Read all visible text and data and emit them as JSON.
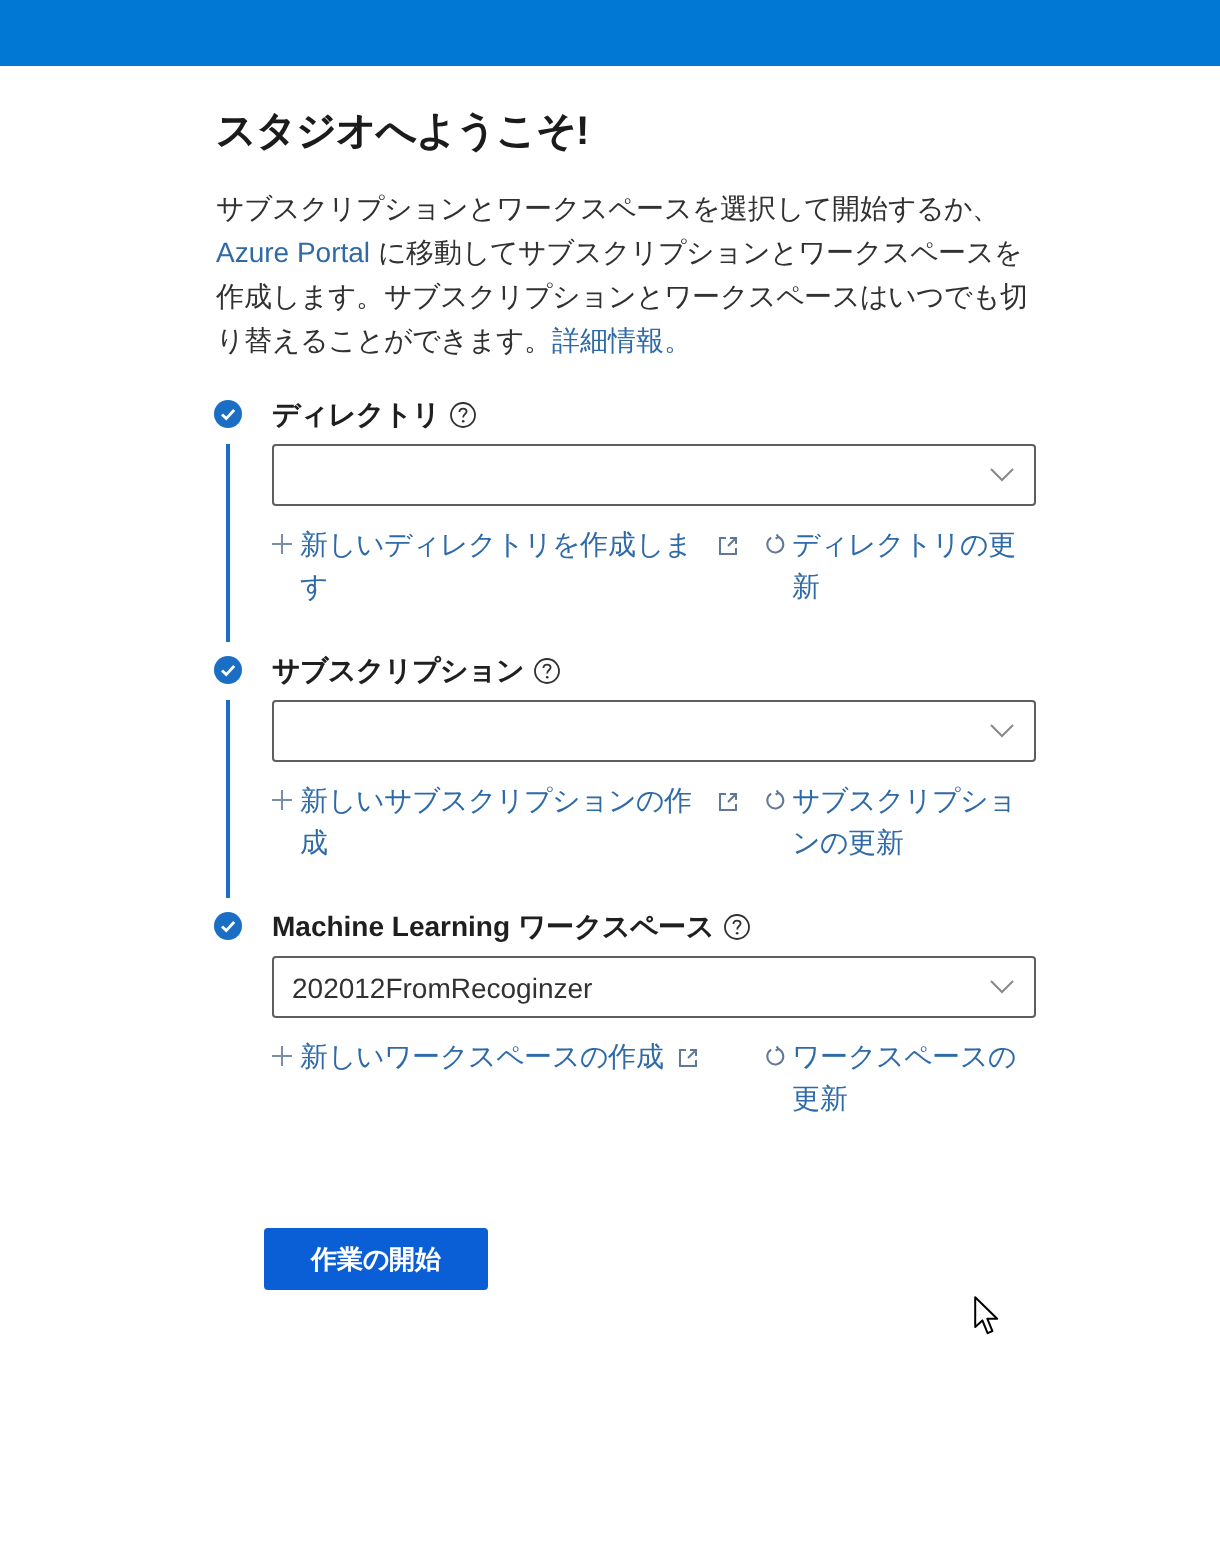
{
  "title": "スタジオへようこそ!",
  "intro": [
    {
      "kind": "text",
      "text": "サブスクリプションとワークスペースを選択して開始するか、"
    },
    {
      "kind": "link",
      "text": "Azure Portal"
    },
    {
      "kind": "text",
      "text": " に移動してサブスクリプションとワークスペースを作成します。サブスクリプションとワークスペースはいつでも切り替えることができます。"
    },
    {
      "kind": "link",
      "text": "詳細情報。"
    }
  ],
  "steps": [
    {
      "label": "ディレクトリ",
      "completed": true,
      "create_link": "新しいディレクトリを作成します",
      "refresh_link": "ディレクトリの更新"
    },
    {
      "label": "サブスクリプション",
      "completed": true,
      "create_link": "新しいサブスクリプションの作成",
      "refresh_link": "サブスクリプションの更新"
    },
    {
      "label": "Machine Learning ワークスペース",
      "completed": true,
      "value": "202012FromRecoginzer",
      "create_link": "新しいワークスペースの作成",
      "refresh_link": "ワークスペースの更新"
    }
  ],
  "start_button": "作業の開始"
}
